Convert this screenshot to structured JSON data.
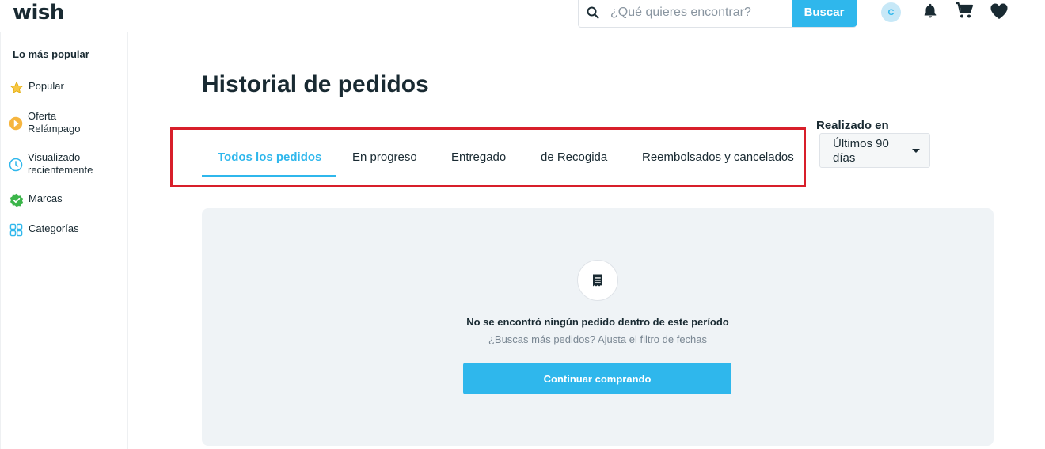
{
  "header": {
    "logo": "wish",
    "search_placeholder": "¿Qué quieres encontrar?",
    "search_button": "Buscar",
    "avatar_initial": "C"
  },
  "sidebar": {
    "title": "Lo más popular",
    "items": [
      {
        "label": "Popular",
        "icon": "star-icon"
      },
      {
        "label": "Oferta Relámpago",
        "icon": "flash-deal-icon"
      },
      {
        "label": "Visualizado recientemente",
        "icon": "clock-icon"
      },
      {
        "label": "Marcas",
        "icon": "verified-badge-icon"
      },
      {
        "label": "Categorías",
        "icon": "categories-grid-icon"
      }
    ]
  },
  "main": {
    "title": "Historial de pedidos",
    "tabs": [
      {
        "label": "Todos los pedidos",
        "active": true
      },
      {
        "label": "En progreso"
      },
      {
        "label": "Entregado"
      },
      {
        "label": "de Recogida"
      },
      {
        "label": "Reembolsados y cancelados"
      }
    ],
    "filter": {
      "label": "Realizado en",
      "selected": "Últimos 90 días"
    },
    "empty_state": {
      "title": "No se encontró ningún pedido dentro de este período",
      "subtitle": "¿Buscas más pedidos? Ajusta el filtro de fechas",
      "button": "Continuar comprando"
    }
  },
  "colors": {
    "accent": "#2fb7ec",
    "highlight": "#d81f2a",
    "text": "#192a32",
    "panel": "#eff3f6"
  }
}
